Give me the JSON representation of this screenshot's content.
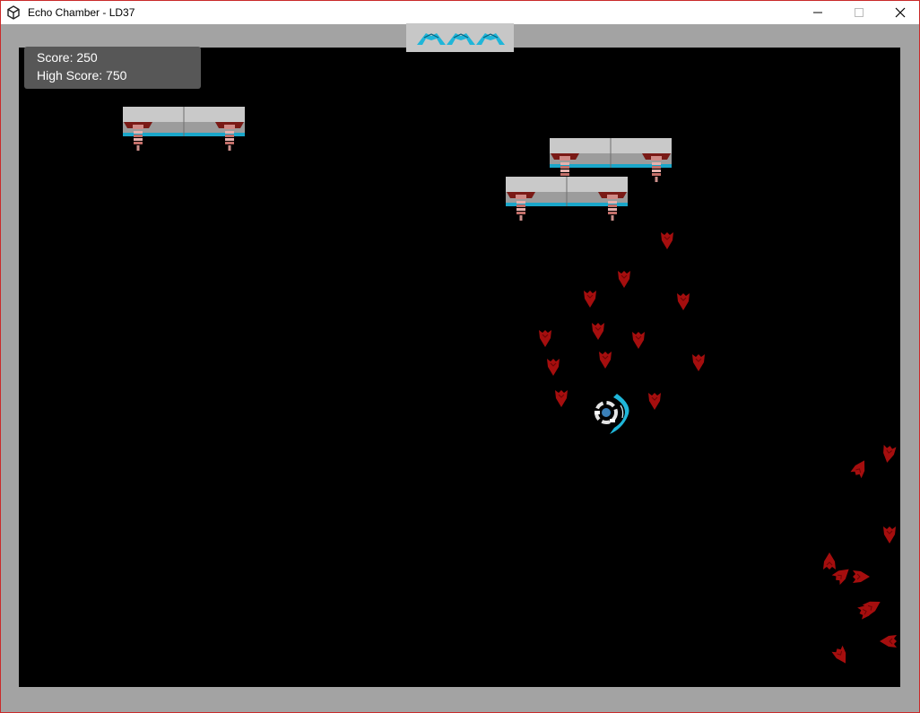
{
  "window": {
    "title": "Echo Chamber - LD37",
    "icon": "unity-icon",
    "controls": [
      "minimize-icon",
      "maximize-icon",
      "close-icon"
    ]
  },
  "hud": {
    "score_text": "Score: 250",
    "high_score_text": "High Score: 750",
    "lives_remaining": 3
  },
  "colors": {
    "frame_border": "#c92a2a",
    "bezel": "#a3a3a3",
    "background": "#000000",
    "enemy": "#a50e0e",
    "player_shield": "#1fb6d9",
    "station_metal": "#bdbdbd",
    "station_trim": "#7a1a16",
    "station_stripe": "#1aa6c9"
  },
  "game": {
    "space_stations": 3,
    "red_enemy_ships": 29,
    "player": "player-ship"
  }
}
